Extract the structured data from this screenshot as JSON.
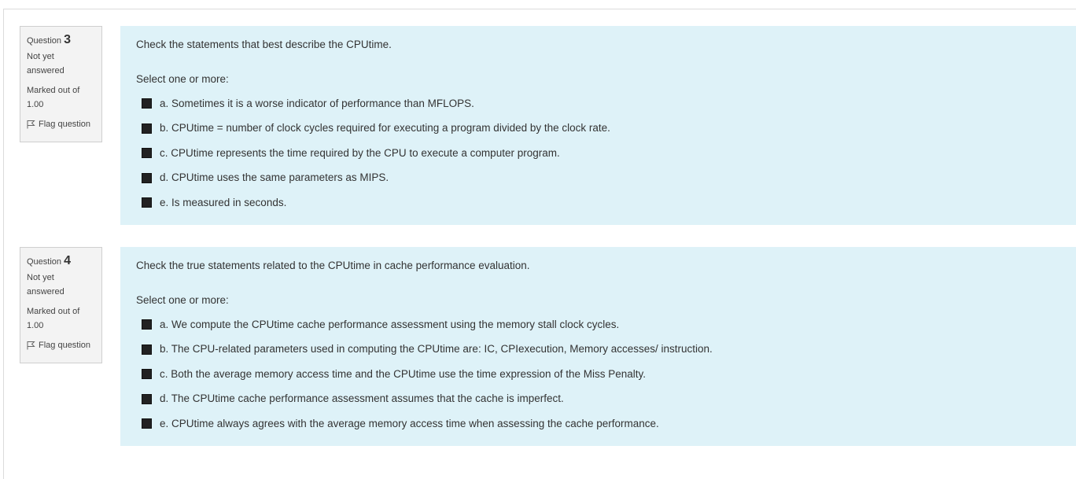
{
  "questions": [
    {
      "label_prefix": "Question",
      "number": "3",
      "state": "Not yet answered",
      "grade": "Marked out of 1.00",
      "flag_label": "Flag question",
      "text": "Check the statements that best describe the CPUtime.",
      "prompt": "Select one or more:",
      "answers": [
        "a. Sometimes it is a worse indicator of performance than MFLOPS.",
        "b. CPUtime = number of clock cycles required for executing a program divided by the clock rate.",
        "c. CPUtime represents the time required by the CPU to execute a computer program.",
        "d. CPUtime uses the same parameters as MIPS.",
        "e. Is measured in seconds."
      ]
    },
    {
      "label_prefix": "Question",
      "number": "4",
      "state": "Not yet answered",
      "grade": "Marked out of 1.00",
      "flag_label": "Flag question",
      "text": "Check the true statements related to the CPUtime in cache performance evaluation.",
      "prompt": "Select one or more:",
      "answers": [
        "a. We compute the CPUtime cache performance assessment using the memory stall clock cycles.",
        "b. The CPU-related parameters used in computing the CPUtime are: IC, CPIexecution, Memory accesses/ instruction.",
        "c. Both the average memory access time and the CPUtime use the time expression of the Miss Penalty.",
        "d. The CPUtime cache performance assessment assumes that the cache is imperfect.",
        "e. CPUtime always agrees with the average memory access time when assessing the cache performance."
      ]
    }
  ],
  "colors": {
    "content_bg": "#def2f8",
    "info_bg": "#f3f3f3",
    "checkbox": "#222222"
  },
  "icons": {
    "flag": "flag-icon"
  }
}
